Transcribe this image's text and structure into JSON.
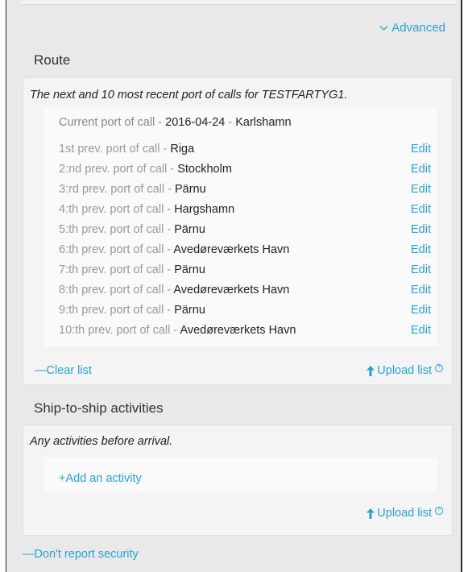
{
  "header": {
    "advanced_label": "Advanced"
  },
  "route": {
    "title": "Route",
    "description": "The next and 10 most recent port of calls for TESTFARTYG1.",
    "current": {
      "label": "Current port of call - ",
      "date": "2016-04-24",
      "separator": " - ",
      "port": "Karlshamn"
    },
    "previous": [
      {
        "label": "1st prev. port of call - ",
        "port": "Riga",
        "edit": "Edit"
      },
      {
        "label": "2:nd prev. port of call - ",
        "port": "Stockholm",
        "edit": "Edit"
      },
      {
        "label": "3:rd prev. port of call - ",
        "port": "Pärnu",
        "edit": "Edit"
      },
      {
        "label": "4:th prev. port of call - ",
        "port": "Hargshamn",
        "edit": "Edit"
      },
      {
        "label": "5:th prev. port of call - ",
        "port": "Pärnu",
        "edit": "Edit"
      },
      {
        "label": "6:th prev. port of call - ",
        "port": "Avedøreværkets Havn",
        "edit": "Edit"
      },
      {
        "label": "7:th prev. port of call - ",
        "port": "Pärnu",
        "edit": "Edit"
      },
      {
        "label": "8:th prev. port of call - ",
        "port": "Avedøreværkets Havn",
        "edit": "Edit"
      },
      {
        "label": "9:th prev. port of call - ",
        "port": "Pärnu",
        "edit": "Edit"
      },
      {
        "label": "10:th prev. port of call - ",
        "port": "Avedøreværkets Havn",
        "edit": "Edit"
      }
    ],
    "clear_label": "—Clear list",
    "upload_label": "Upload list"
  },
  "s2s": {
    "title": "Ship-to-ship activities",
    "description": "Any activities before arrival.",
    "add_label": "+Add an activity",
    "upload_label": "Upload list"
  },
  "security": {
    "dont_report_label": "—Don't report security"
  },
  "colors": {
    "accent": "#2aa1d3",
    "panel": "#f4f4f4",
    "background": "#e9e9e9"
  },
  "icons": {
    "advanced": "chevron-down-icon",
    "upload": "upload-arrow-icon",
    "help": "help-circle-icon"
  }
}
